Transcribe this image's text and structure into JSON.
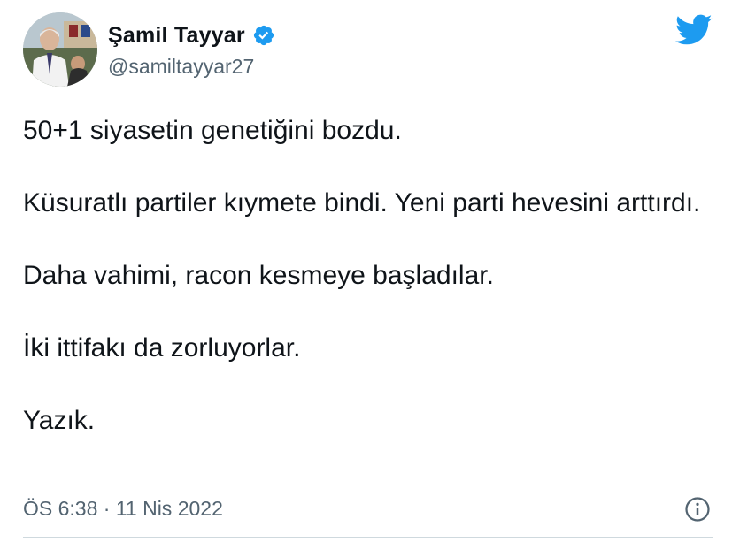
{
  "tweet": {
    "author": {
      "display_name": "Şamil Tayyar",
      "handle": "@samiltayyar27",
      "verified": true,
      "avatar": "profile-photo"
    },
    "paragraphs": [
      "50+1 siyasetin genetiğini bozdu.",
      "Küsuratlı partiler kıymete bindi. Yeni parti hevesini arttırdı.",
      "Daha vahimi, racon kesmeye başladılar.",
      "İki ittifakı da zorluyorlar.",
      "Yazık."
    ],
    "timestamp": "ÖS 6:38 · 11 Nis 2022",
    "icons": {
      "brand": "twitter-bird-icon",
      "verified": "verified-badge-icon",
      "info": "info-icon"
    }
  },
  "colors": {
    "brand_blue": "#1d9bf0",
    "text_primary": "#0f1419",
    "text_secondary": "#536471",
    "divider": "#cfd9de"
  }
}
